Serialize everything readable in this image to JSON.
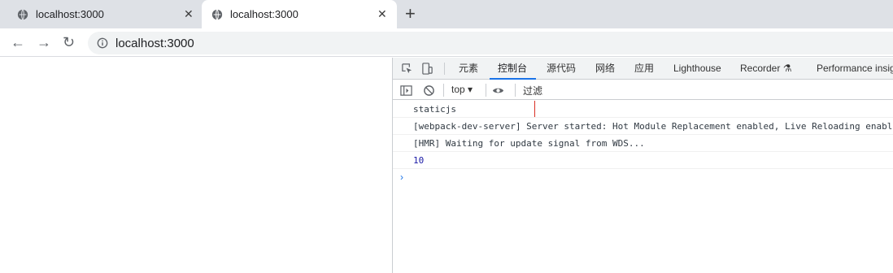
{
  "tabs": [
    {
      "title": "localhost:3000",
      "close": "✕"
    },
    {
      "title": "localhost:3000",
      "close": "✕"
    }
  ],
  "new_tab": "+",
  "nav": {
    "back": "←",
    "forward": "→",
    "reload": "↻"
  },
  "address": {
    "url": "localhost:3000"
  },
  "devtools": {
    "tabs": [
      "元素",
      "控制台",
      "源代码",
      "网络",
      "应用",
      "Lighthouse",
      "Recorder ⚗",
      "Performance insig"
    ],
    "active_tab": "控制台",
    "context": "top ▾",
    "filter_placeholder": "过滤"
  },
  "console": {
    "messages": [
      "staticjs",
      "[webpack-dev-server] Server started: Hot Module Replacement enabled, Live Reloading enabled",
      "[HMR] Waiting for update signal from WDS...",
      "10"
    ],
    "prompt": "›"
  },
  "colors": {
    "accent": "#1a73e8",
    "highlight": "#d93025"
  }
}
